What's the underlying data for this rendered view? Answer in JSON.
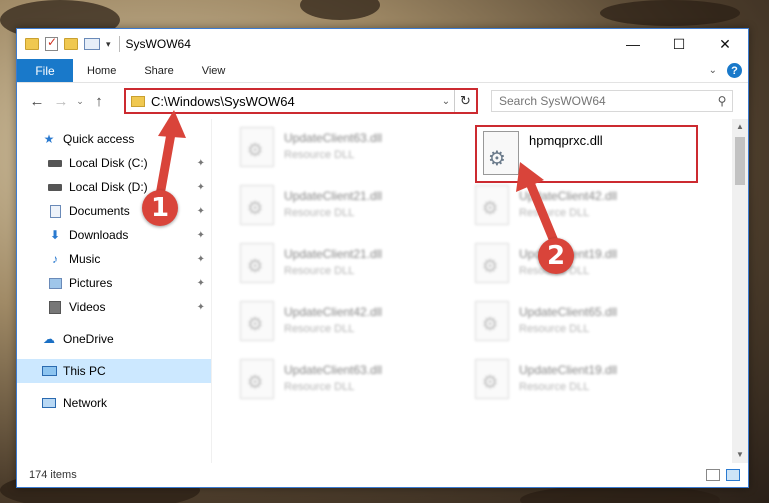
{
  "window": {
    "title": "SysWOW64",
    "controls": {
      "minimize": "—",
      "maximize": "☐",
      "close": "✕"
    }
  },
  "ribbon": {
    "file_tab": "File",
    "tabs": [
      "Home",
      "Share",
      "View"
    ],
    "help": "?",
    "expand": "⌄"
  },
  "nav": {
    "back": "←",
    "forward": "→",
    "recent": "⌄",
    "up": "↑",
    "address": "C:\\Windows\\SysWOW64",
    "address_dropdown": "⌄",
    "refresh": "↻",
    "search_placeholder": "Search SysWOW64",
    "search_icon": "⚲"
  },
  "sidebar": {
    "quick_access": "Quick access",
    "items": [
      {
        "label": "Local Disk (C:)",
        "icon": "drive-icon",
        "pinned": true
      },
      {
        "label": "Local Disk (D:)",
        "icon": "drive-icon",
        "pinned": true
      },
      {
        "label": "Documents",
        "icon": "documents-icon",
        "pinned": true
      },
      {
        "label": "Downloads",
        "icon": "downloads-icon",
        "pinned": true
      },
      {
        "label": "Music",
        "icon": "music-icon",
        "pinned": true
      },
      {
        "label": "Pictures",
        "icon": "pictures-icon",
        "pinned": true
      },
      {
        "label": "Videos",
        "icon": "videos-icon",
        "pinned": true
      }
    ],
    "onedrive": "OneDrive",
    "this_pc": "This PC",
    "network": "Network",
    "pin_glyph": "📌"
  },
  "files": {
    "highlighted": {
      "name": "hpmqprxc.dll"
    },
    "blurred": [
      {
        "name": "UpdateClient63.dll",
        "type": "Resource DLL"
      },
      {
        "name": "UpdateClient21.dll",
        "type": "Resource DLL"
      },
      {
        "name": "UpdateClient42.dll",
        "type": "Resource DLL"
      },
      {
        "name": "UpdateClient21.dll",
        "type": "Resource DLL"
      },
      {
        "name": "UpdateClient19.dll",
        "type": "Resource DLL"
      },
      {
        "name": "UpdateClient42.dll",
        "type": "Resource DLL"
      },
      {
        "name": "UpdateClient65.dll",
        "type": "Resource DLL"
      },
      {
        "name": "UpdateClient63.dll",
        "type": "Resource DLL"
      },
      {
        "name": "UpdateClient19.dll",
        "type": "Resource DLL"
      }
    ]
  },
  "status": {
    "count": "174 items"
  },
  "callouts": [
    "1",
    "2"
  ],
  "colors": {
    "accent": "#1979ca",
    "highlight": "#cc2a30",
    "callout": "#d9443a",
    "selected": "#cce8ff"
  }
}
